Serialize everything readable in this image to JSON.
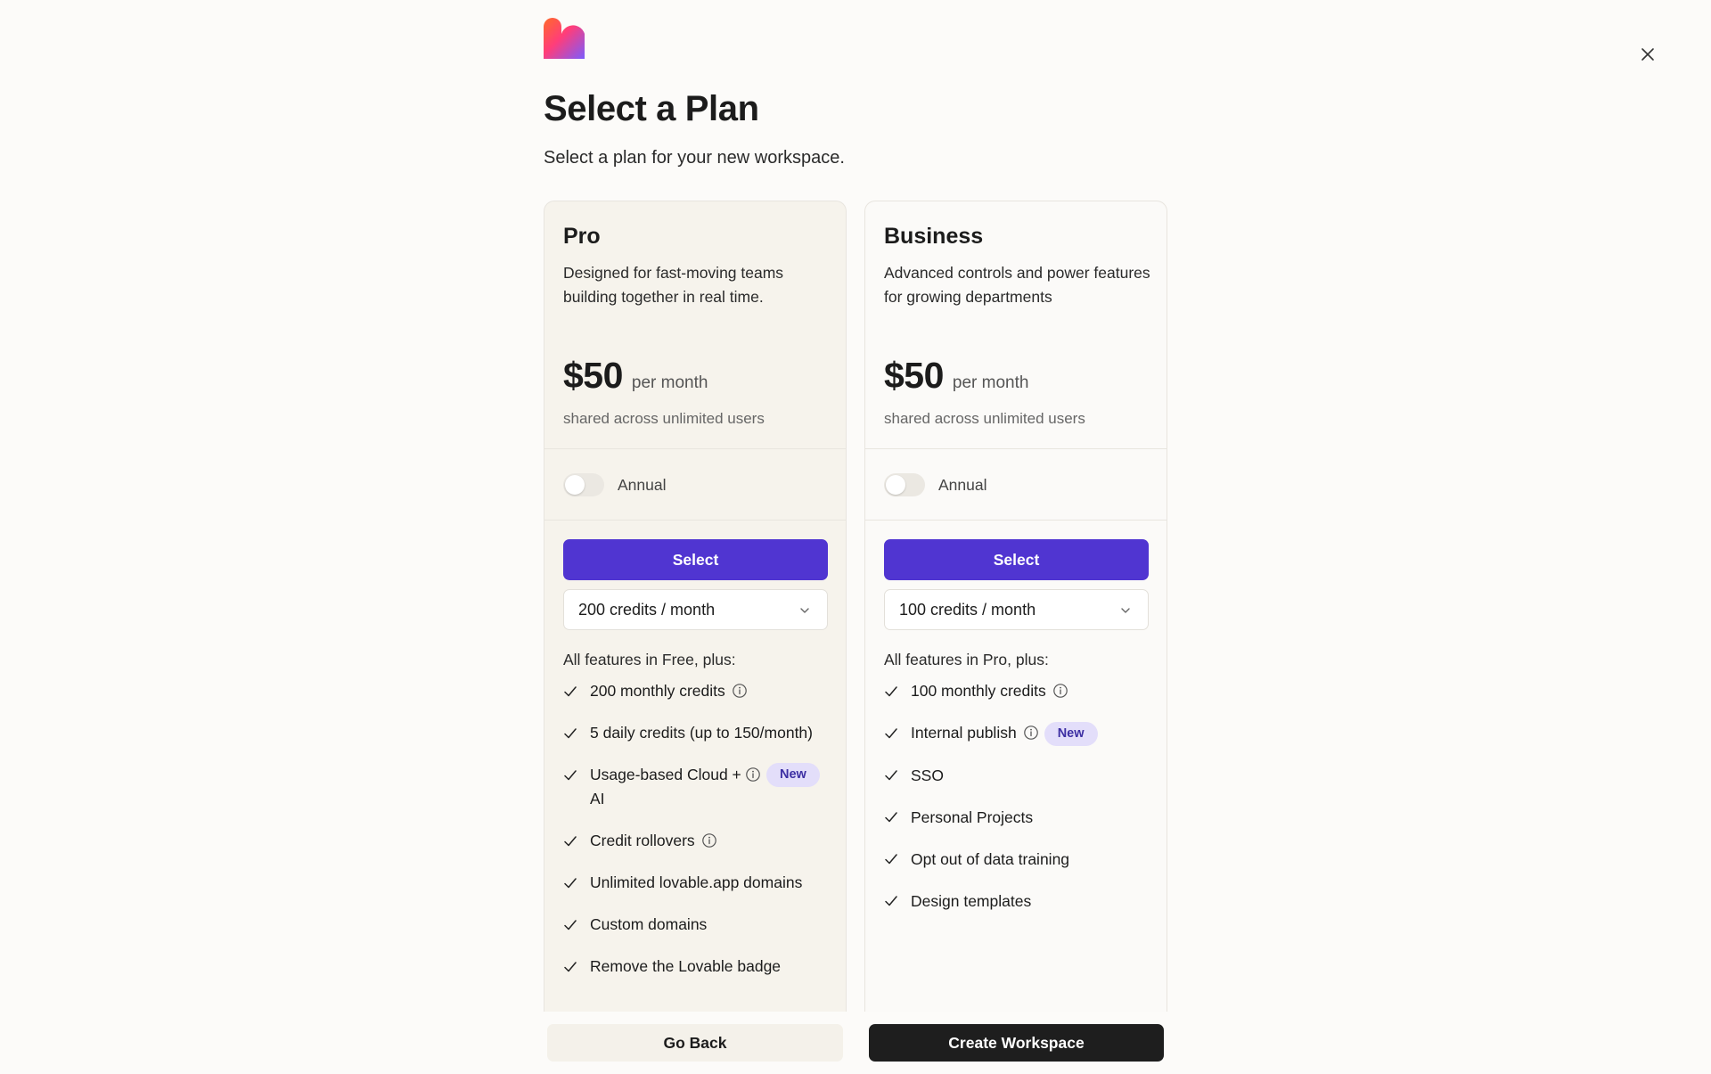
{
  "header": {
    "title": "Select a Plan",
    "subtitle": "Select a plan for your new workspace."
  },
  "colors": {
    "accent": "#5035d1",
    "badge_bg": "#e3defa",
    "primary_dark": "#1e1e1e"
  },
  "plans": [
    {
      "name": "Pro",
      "description": "Designed for fast-moving teams building together in real time.",
      "price": "$50",
      "period": "per month",
      "shared_note": "shared across unlimited users",
      "annual_label": "Annual",
      "annual_enabled": false,
      "select_label": "Select",
      "credits_selected": "200 credits / month",
      "features_heading": "All features in Free, plus:",
      "features": [
        {
          "text": "200 monthly credits",
          "info": true,
          "badge": ""
        },
        {
          "text": "5 daily credits (up to 150/month)",
          "info": false,
          "badge": ""
        },
        {
          "text": "Usage-based Cloud + AI",
          "info": true,
          "badge": "New"
        },
        {
          "text": "Credit rollovers",
          "info": true,
          "badge": ""
        },
        {
          "text": "Unlimited lovable.app domains",
          "info": false,
          "badge": ""
        },
        {
          "text": "Custom domains",
          "info": false,
          "badge": ""
        },
        {
          "text": "Remove the Lovable badge",
          "info": false,
          "badge": ""
        }
      ]
    },
    {
      "name": "Business",
      "description": "Advanced controls and power features for growing departments",
      "price": "$50",
      "period": "per month",
      "shared_note": "shared across unlimited users",
      "annual_label": "Annual",
      "annual_enabled": false,
      "select_label": "Select",
      "credits_selected": "100 credits / month",
      "features_heading": "All features in Pro, plus:",
      "features": [
        {
          "text": "100 monthly credits",
          "info": true,
          "badge": ""
        },
        {
          "text": "Internal publish",
          "info": true,
          "badge": "New"
        },
        {
          "text": "SSO",
          "info": false,
          "badge": ""
        },
        {
          "text": "Personal Projects",
          "info": false,
          "badge": ""
        },
        {
          "text": "Opt out of data training",
          "info": false,
          "badge": ""
        },
        {
          "text": "Design templates",
          "info": false,
          "badge": ""
        }
      ]
    }
  ],
  "footer": {
    "back_label": "Go Back",
    "create_label": "Create Workspace"
  }
}
